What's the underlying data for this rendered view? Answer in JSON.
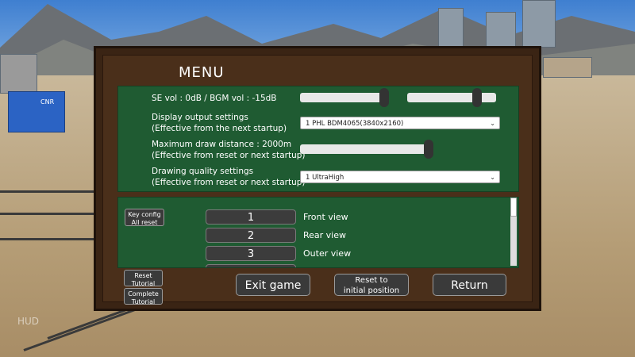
{
  "menu": {
    "title": "MENU"
  },
  "settings": {
    "volume_label": "SE vol : 0dB / BGM vol : -15dB",
    "display_label_1": "Display output settings",
    "display_label_2": "(Effective from the next startup)",
    "display_value": "1 PHL BDM4065(3840x2160)",
    "draw_label_1": "Maximum draw distance : 2000m",
    "draw_label_2": "(Effective from reset or next startup)",
    "quality_label_1": "Drawing quality settings",
    "quality_label_2": "(Effective from reset or next startup)",
    "quality_value": "1 UltraHigh",
    "se_volume_level": 0.82,
    "bgm_volume_level": 0.78,
    "draw_distance_level": 0.98
  },
  "keyconfig": {
    "reset_all_1": "Key config",
    "reset_all_2": "All reset",
    "rows": [
      {
        "key": "1",
        "label": "Front view"
      },
      {
        "key": "2",
        "label": "Rear view"
      },
      {
        "key": "3",
        "label": "Outer view"
      }
    ]
  },
  "side_buttons": {
    "reset_tutorial_1": "Reset",
    "reset_tutorial_2": "Tutorial",
    "complete_tutorial_1": "Complete",
    "complete_tutorial_2": "Tutorial"
  },
  "actions": {
    "exit": "Exit game",
    "reset_1": "Reset to",
    "reset_2": "initial position",
    "return": "Return"
  },
  "hud": {
    "label": "HUD"
  },
  "scene": {
    "container_text": "CNR"
  }
}
